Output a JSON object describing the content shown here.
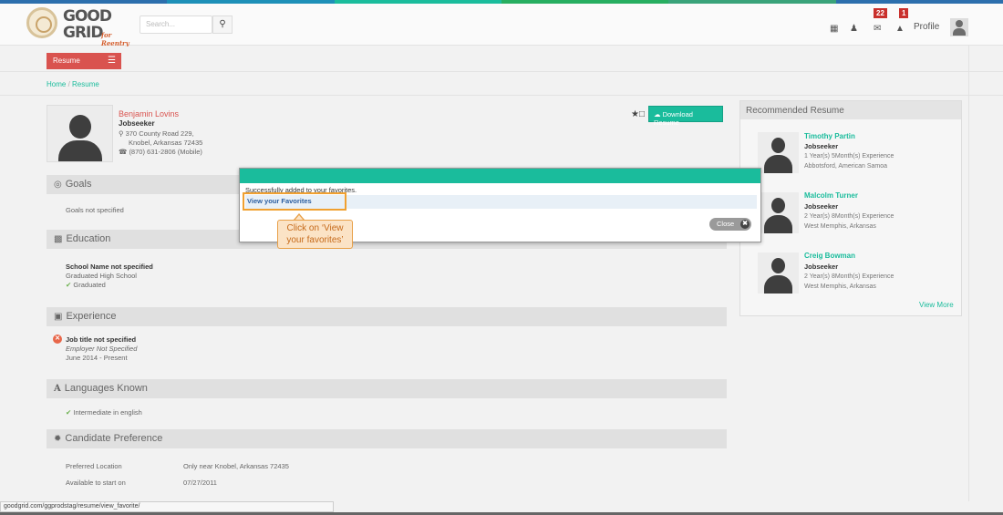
{
  "topstripe_colors": [
    "#2c6fad",
    "#1e90b8",
    "#1abc9c",
    "#27ae60",
    "#3aa37a",
    "#2c6fad"
  ],
  "header": {
    "search_placeholder": "Search...",
    "messages_badge": "22",
    "notifications_badge": "1",
    "profile_label": "Profile"
  },
  "subnav": {
    "resume_tab": "Resume"
  },
  "breadcrumb": {
    "home": "Home",
    "sep": " / ",
    "current": "Resume"
  },
  "candidate": {
    "name": "Benjamin Lovins",
    "role": "Jobseeker",
    "address_line1": "370 County Road 229,",
    "address_line2": "Knobel, Arkansas 72435",
    "phone": "(870) 631-2806 (Mobile)",
    "download_label": "Download Resume"
  },
  "sections": {
    "goals": {
      "title": "Goals",
      "text": "Goals not specified"
    },
    "education": {
      "title": "Education",
      "school": "School Name not specified",
      "degree": "Graduated High School",
      "status": "Graduated"
    },
    "experience": {
      "title": "Experience",
      "job": "Job title not specified",
      "employer": "Employer Not Specified",
      "period": "June 2014 - Present"
    },
    "languages": {
      "title": "Languages Known",
      "item": "Intermediate in english"
    },
    "preference": {
      "title": "Candidate Preference",
      "location_label": "Preferred Location",
      "location_value": "Only near Knobel, Arkansas 72435",
      "start_label": "Available to start on",
      "start_value": "07/27/2011"
    }
  },
  "recommended": {
    "title": "Recommended Resume",
    "items": [
      {
        "name": "Timothy Partin",
        "role": "Jobseeker",
        "exp": "1 Year(s) 5Month(s) Experience",
        "loc": "Abbotsford, American Samoa"
      },
      {
        "name": "Malcolm Turner",
        "role": "Jobseeker",
        "exp": "2 Year(s) 8Month(s) Experience",
        "loc": "West Memphis, Arkansas"
      },
      {
        "name": "Creig Bowman",
        "role": "Jobseeker",
        "exp": "2 Year(s) 8Month(s) Experience",
        "loc": "West Memphis, Arkansas"
      }
    ],
    "view_more": "View More"
  },
  "modal": {
    "message": "Successfully added to your favorites.",
    "link": "View your Favorites",
    "close": "Close"
  },
  "callout": {
    "text": "Click on ‘View your favorites’"
  },
  "status_url": "goodgrid.com/ggprodstag/resume/view_favorite/",
  "logo": {
    "good": "GOOD",
    "grid": "GRID",
    "reentry": "for Reentry"
  }
}
